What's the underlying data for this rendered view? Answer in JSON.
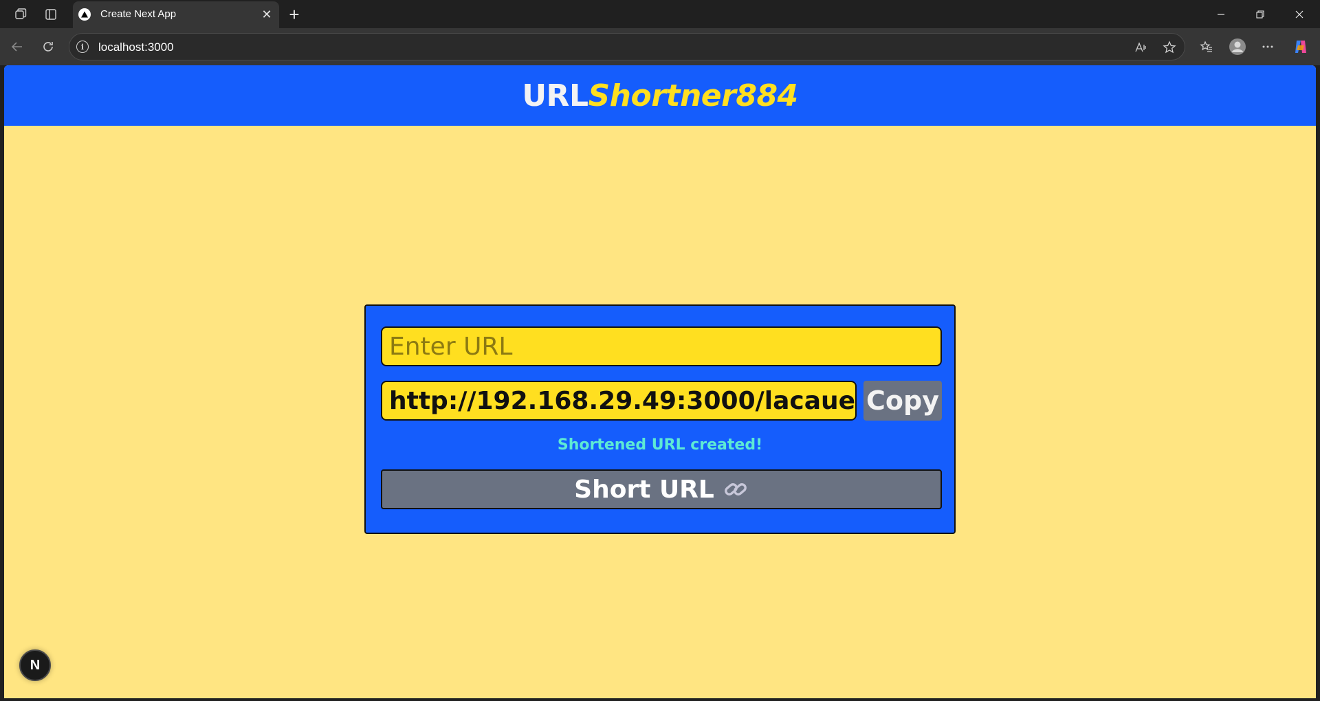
{
  "browser": {
    "tab_title": "Create Next App",
    "address": "localhost:3000"
  },
  "header": {
    "brand_prefix": "URL",
    "brand_suffix": "Shortner884"
  },
  "form": {
    "url_input_placeholder": "Enter URL",
    "url_input_value": "",
    "short_url_value": "http://192.168.29.49:3000/lacaue",
    "copy_label": "Copy",
    "status_message": "Shortened URL created!",
    "submit_label": "Short URL"
  },
  "next_badge": "N",
  "colors": {
    "page_bg": "#ffe582",
    "header_bg": "#155dfc",
    "card_bg": "#155dfc",
    "input_bg": "#ffdf20",
    "button_bg": "#6a7282",
    "brand_accent": "#ffdf20",
    "status_text": "#5eead4"
  },
  "icons": {
    "submit_icon": "link-icon"
  }
}
